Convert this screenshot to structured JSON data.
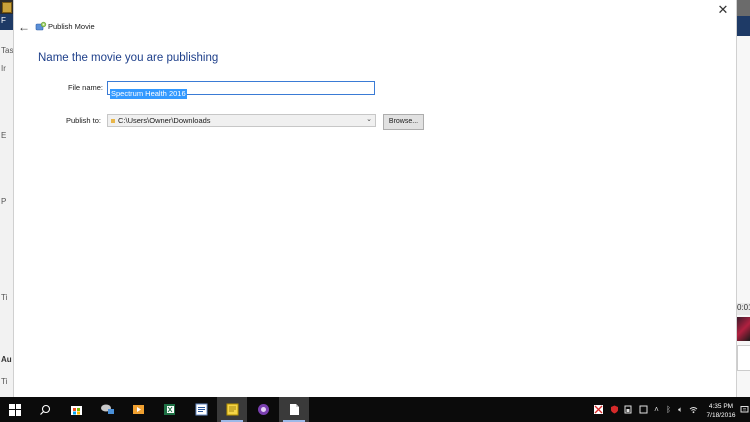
{
  "background_app": {
    "left_edge_letters": [
      "F",
      "Tas",
      "Ir",
      "E",
      "P",
      "Ti",
      "Au",
      "Ti"
    ],
    "right_edge_timecode": "0:01:"
  },
  "dialog": {
    "title": "Publish Movie",
    "heading": "Name the movie you are publishing",
    "file_name_label": "File name:",
    "file_name_value": "Spectrum Health 2016",
    "publish_to_label": "Publish to:",
    "publish_to_value": "C:\\Users\\Owner\\Downloads",
    "browse_label": "Browse...",
    "heading_color": "#1e3f8a"
  },
  "taskbar": {
    "items": [
      {
        "name": "start",
        "icon": "windows-logo-icon"
      },
      {
        "name": "search",
        "icon": "search-icon"
      },
      {
        "name": "store",
        "icon": "store-icon"
      },
      {
        "name": "media-app",
        "icon": "media-app-icon"
      },
      {
        "name": "video-player",
        "icon": "video-player-icon"
      },
      {
        "name": "spreadsheet",
        "icon": "spreadsheet-icon"
      },
      {
        "name": "document-viewer",
        "icon": "document-viewer-icon"
      },
      {
        "name": "notes",
        "icon": "sticky-notes-icon"
      },
      {
        "name": "purple-app",
        "icon": "purple-app-icon"
      },
      {
        "name": "file-explorer",
        "icon": "blank-document-icon"
      }
    ],
    "tray": [
      "security-icon",
      "shield-icon",
      "battery-icon",
      "device-icon",
      "chevron-up-icon",
      "bluetooth-icon",
      "volume-icon",
      "wifi-icon",
      "notification-icon"
    ],
    "time": "4:35 PM",
    "date": "7/18/2016"
  }
}
